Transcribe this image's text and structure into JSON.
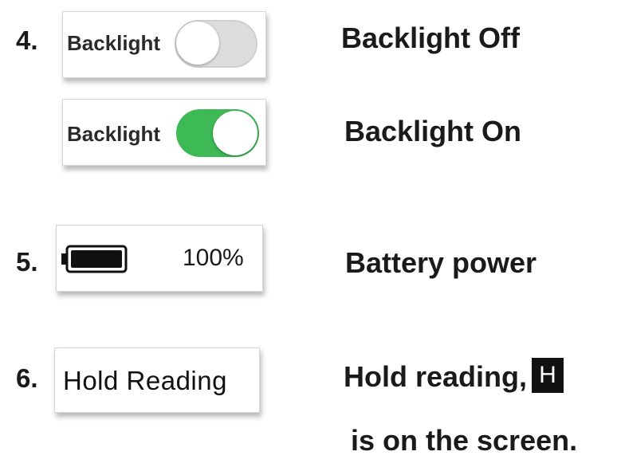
{
  "items": [
    {
      "number": "4.",
      "off_card": {
        "label": "Backlight",
        "state": "off"
      },
      "on_card": {
        "label": "Backlight",
        "state": "on"
      },
      "desc_off": "Backlight Off",
      "desc_on": "Backlight On"
    },
    {
      "number": "5.",
      "battery": {
        "icon": "battery-full-icon",
        "level_percent": 100,
        "text": "100%"
      },
      "desc": "Battery power"
    },
    {
      "number": "6.",
      "hold_card": {
        "label": "Hold Reading"
      },
      "desc_line1": "Hold reading,",
      "hold_indicator": "H",
      "desc_line2": "is on the screen."
    }
  ],
  "colors": {
    "switch_on": "#3dba55",
    "switch_off": "#dcdcdc",
    "text": "#1a1a1a",
    "indicator_bg": "#111111"
  }
}
